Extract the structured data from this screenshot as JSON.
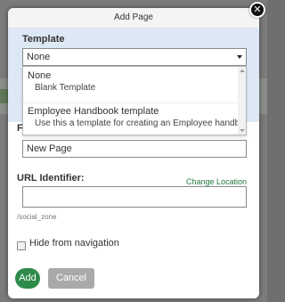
{
  "dialog": {
    "title": "Add Page",
    "close_glyph": "✕"
  },
  "template": {
    "label": "Template",
    "selected": "None",
    "options": [
      {
        "name": "None",
        "description": "Blank Template"
      },
      {
        "name": "Employee Handbook template",
        "description": "Use this a template for creating an Employee handbo"
      }
    ]
  },
  "page_name": {
    "label_visible_char": "F",
    "value": "New Page"
  },
  "url_identifier": {
    "label": "URL Identifier:",
    "change_location_link": "Change Location",
    "value": "",
    "hint": "/social_zone"
  },
  "hide_from_navigation": {
    "label": "Hide from navigation",
    "checked": false
  },
  "buttons": {
    "add": "Add",
    "cancel": "Cancel"
  },
  "colors": {
    "accent_green": "#2e8b4a",
    "link_green": "#1f7a3a",
    "template_section_bg": "#dde8f5"
  }
}
